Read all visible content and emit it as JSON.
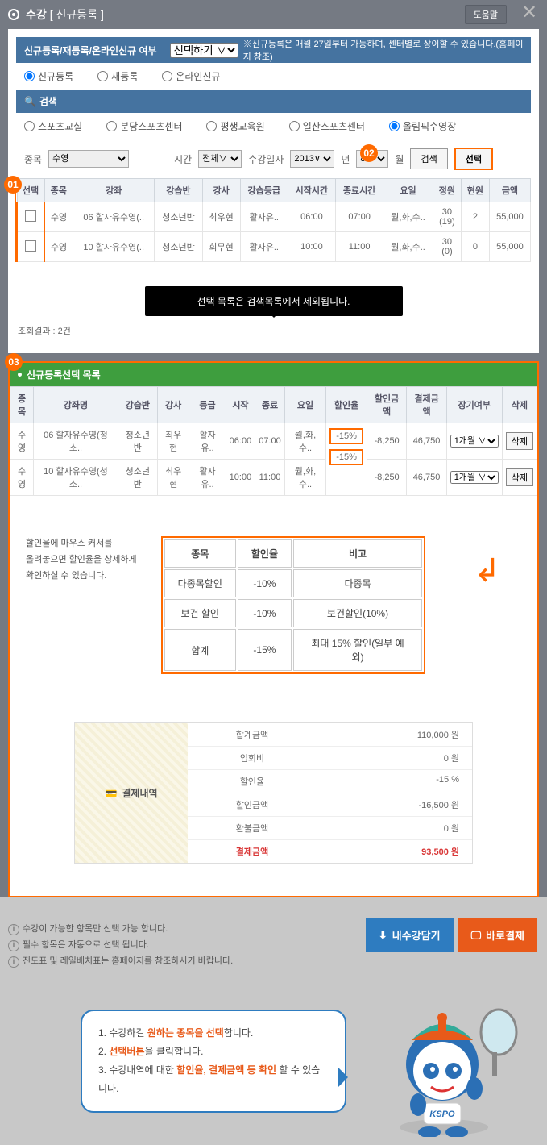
{
  "title_main": "수강",
  "title_sub": "[ 신규등록 ]",
  "help_btn": "도움말",
  "reg_section": "신규등록/재등록/온라인신규 여부",
  "reg_select": "선택하기 ∨",
  "reg_note": "※신규등록은 매월 27일부터 가능하며, 센터별로 상이할 수 있습니다.(홈페이지 참조)",
  "reg_radios": [
    "신규등록",
    "재등록",
    "온라인신규"
  ],
  "search_title": "검색",
  "center_radios": [
    "스포츠교실",
    "분당스포츠센터",
    "평생교육원",
    "일산스포츠센터",
    "올림픽수영장"
  ],
  "filter": {
    "subject_label": "종목",
    "subject_value": "수영",
    "time_label": "시간",
    "time_value": "전체∨",
    "date_label": "수강일자",
    "date_year": "2013∨",
    "year_suffix": "년",
    "date_month": "8 ∨",
    "month_suffix": "월",
    "search_btn": "검색",
    "select_btn": "선택"
  },
  "search_cols": [
    "선택",
    "종목",
    "강좌",
    "강습반",
    "강사",
    "강습등급",
    "시작시간",
    "종료시간",
    "요일",
    "정원",
    "현원",
    "금액"
  ],
  "search_rows": [
    {
      "subject": "수영",
      "course": "06 할자유수영(..",
      "class": "청소년반",
      "teacher": "최우현",
      "grade": "활자유..",
      "start": "06:00",
      "end": "07:00",
      "days": "월,화,수..",
      "cap": "30\n(19)",
      "cur": "2",
      "price": "55,000"
    },
    {
      "subject": "수영",
      "course": "10 할자유수영(..",
      "class": "청소년반",
      "teacher": "회무현",
      "grade": "활자유..",
      "start": "10:00",
      "end": "11:00",
      "days": "월,화,수..",
      "cap": "30\n(0)",
      "cur": "0",
      "price": "55,000"
    }
  ],
  "black_msg": "선택 목록은 검색목록에서 제외됩니다.",
  "result_count": "조회결과 : 2건",
  "sel_title": "신규등록선택 목록",
  "sel_cols": [
    "종목",
    "강좌명",
    "강습반",
    "강사",
    "등급",
    "시작",
    "종료",
    "요일",
    "할인율",
    "할인금액",
    "결제금액",
    "장기여부",
    "삭제"
  ],
  "sel_rows": [
    {
      "subject": "수영",
      "course": "06 할자유수영(청소..",
      "class": "청소년반",
      "teacher": "최우현",
      "grade": "활자유..",
      "start": "06:00",
      "end": "07:00",
      "days": "월,화,수..",
      "disc": "-15%",
      "discamt": "-8,250",
      "pay": "46,750",
      "long": "1개월 ∨",
      "del": "삭제"
    },
    {
      "subject": "수영",
      "course": "10 할자유수영(청소..",
      "class": "청소년반",
      "teacher": "최우현",
      "grade": "활자유..",
      "start": "10:00",
      "end": "11:00",
      "days": "월,화,수..",
      "disc": "-15%",
      "discamt": "-8,250",
      "pay": "46,750",
      "long": "1개월 ∨",
      "del": "삭제"
    }
  ],
  "hint_text": "할인율에 마우스 커서를\n올려놓으면 할인율을 상세하게\n확인하실 수 있습니다.",
  "disc_cols": [
    "종목",
    "할인율",
    "비고"
  ],
  "disc_rows": [
    [
      "다종목할인",
      "-10%",
      "다종목"
    ],
    [
      "보건 할인",
      "-10%",
      "보건할인(10%)"
    ],
    [
      "합계",
      "-15%",
      "최대 15% 할인(일부 예외)"
    ]
  ],
  "pay_title": "결제내역",
  "pay_rows": [
    [
      "합계금액",
      "110,000 원"
    ],
    [
      "입회비",
      "0 원"
    ],
    [
      "할인율",
      "-15 %"
    ],
    [
      "할인금액",
      "-16,500 원"
    ],
    [
      "환불금액",
      "0 원"
    ],
    [
      "결제금액",
      "93,500 원"
    ]
  ],
  "info": [
    "수강이 가능한 항목만 선택 가능 합니다.",
    "필수 항목은 자동으로 선택 됩니다.",
    "진도표 및 레일배치표는 홈페이지를 참조하시기 바랍니다."
  ],
  "btn_save": "내수강담기",
  "btn_pay": "바로결제",
  "speech": {
    "l1a": "수강하길 ",
    "l1b": "원하는 종목을 선택",
    "l1c": "합니다.",
    "l2a": "",
    "l2b": "선택버튼",
    "l2c": "을 클릭합니다.",
    "l3a": "수강내역에 대한 ",
    "l3b": "할인율, 결제금액 등 확인",
    "l3c": " 할 수 있습니다."
  },
  "badges": {
    "b1": "01",
    "b2": "02",
    "b3": "03"
  }
}
